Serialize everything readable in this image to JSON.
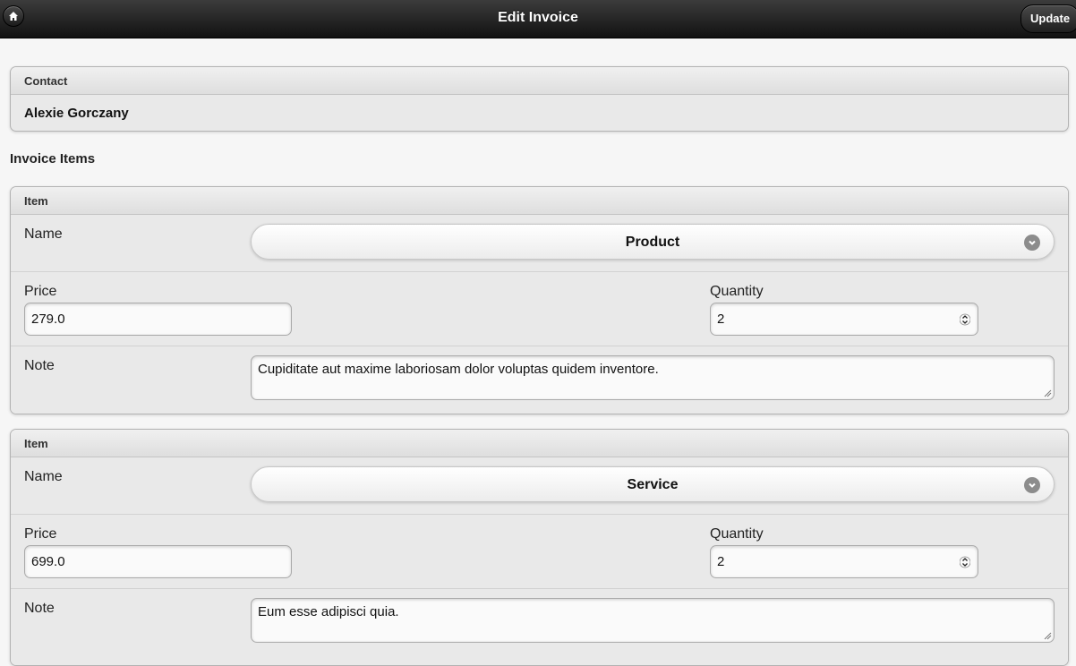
{
  "header": {
    "title": "Edit Invoice",
    "update_label": "Update"
  },
  "contact": {
    "heading": "Contact",
    "name": "Alexie Gorczany"
  },
  "section_title": "Invoice Items",
  "items": [
    {
      "heading": "Item",
      "name_label": "Name",
      "name_value": "Product",
      "price_label": "Price",
      "price_value": "279.0",
      "quantity_label": "Quantity",
      "quantity_value": "2",
      "note_label": "Note",
      "note_value": "Cupiditate aut maxime laboriosam dolor voluptas quidem inventore."
    },
    {
      "heading": "Item",
      "name_label": "Name",
      "name_value": "Service",
      "price_label": "Price",
      "price_value": "699.0",
      "quantity_label": "Quantity",
      "quantity_value": "2",
      "note_label": "Note",
      "note_value": "Eum esse adipisci quia."
    }
  ],
  "colors": {
    "header_bg": "#1a1a1a",
    "page_bg": "#f6f6f6",
    "card_bg": "#e9e9e9"
  },
  "icons": {
    "home": "home-icon",
    "select_arrow": "chevron-down-icon",
    "stepper": "stepper-arrows-icon"
  }
}
